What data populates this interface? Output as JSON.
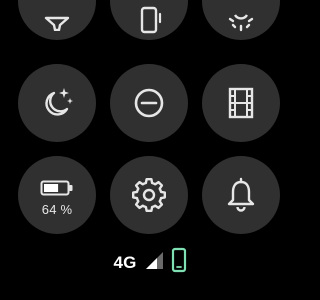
{
  "colors": {
    "tile_bg": "#303030",
    "icon": "#e6e6e6",
    "battery_fill": "#ffffff",
    "phone_accent": "#7fe0b3"
  },
  "tiles": [
    {
      "name": "flashlight-tile",
      "icon": "flashlight-icon",
      "state": "partially-visible"
    },
    {
      "name": "phone-tile",
      "icon": "phone-vibrate-icon",
      "state": "partially-visible"
    },
    {
      "name": "brightness-tile",
      "icon": "brightness-icon",
      "state": "partially-visible"
    },
    {
      "name": "bedtime-tile",
      "icon": "moon-stars-icon"
    },
    {
      "name": "do-not-disturb-tile",
      "icon": "minus-circle-icon"
    },
    {
      "name": "theater-mode-tile",
      "icon": "film-strip-icon"
    },
    {
      "name": "battery-tile",
      "icon": "battery-icon"
    },
    {
      "name": "settings-tile",
      "icon": "gear-icon"
    },
    {
      "name": "alarm-tile",
      "icon": "bell-icon"
    }
  ],
  "battery": {
    "level": 64,
    "label": "64 %"
  },
  "status": {
    "network": "4G",
    "signal_icon": "signal-icon",
    "phone_icon": "phone-connected-icon"
  }
}
